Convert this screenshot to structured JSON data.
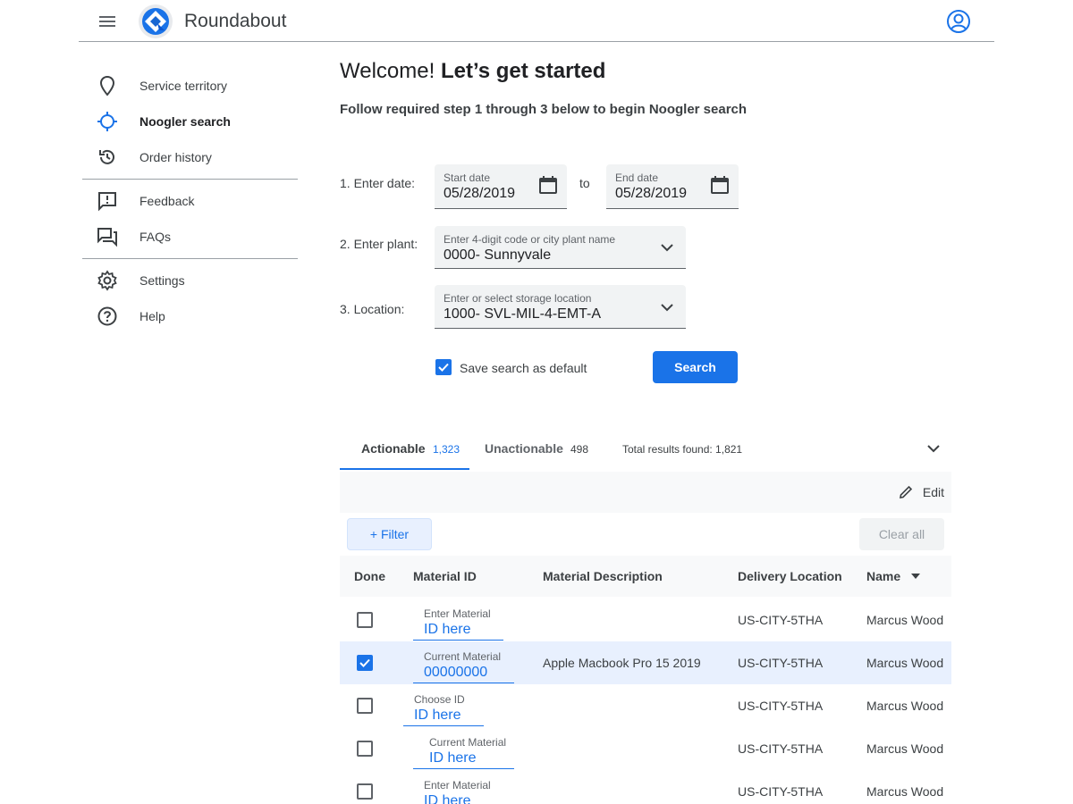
{
  "app": {
    "title": "Roundabout",
    "accent": "#1a73e8"
  },
  "sidebar": {
    "items": [
      {
        "label": "Service territory",
        "icon": "map-pin-icon"
      },
      {
        "label": "Noogler search",
        "icon": "crosshair-icon",
        "active": true
      },
      {
        "label": "Order history",
        "icon": "history-icon"
      },
      {
        "label": "Feedback",
        "icon": "feedback-icon"
      },
      {
        "label": "FAQs",
        "icon": "forum-icon"
      },
      {
        "label": "Settings",
        "icon": "gear-icon"
      },
      {
        "label": "Help",
        "icon": "help-icon"
      }
    ]
  },
  "main": {
    "welcome": "Welcome!",
    "welcome_bold": "Let’s get started",
    "subtitle": "Follow required step 1 through 3 below to begin Noogler search"
  },
  "form": {
    "step1_label": "1. Enter date:",
    "start_label": "Start date",
    "start_value": "05/28/2019",
    "to_text": "to",
    "end_label": "End date",
    "end_value": "05/28/2019",
    "step2_label": "2. Enter plant:",
    "plant_label": "Enter 4-digit code or city plant name",
    "plant_value": "0000- Sunnyvale",
    "step3_label": "3. Location:",
    "location_label": "Enter or select storage location",
    "location_value": "1000- SVL-MIL-4-EMT-A",
    "save_default_label": "Save search as default",
    "save_default_checked": true,
    "search_label": "Search"
  },
  "results": {
    "tab_actionable": "Actionable",
    "tab_actionable_count": "1,323",
    "tab_unactionable": "Unactionable",
    "tab_unactionable_count": "498",
    "total": "Total results found: 1,821",
    "edit_label": "Edit",
    "filter_label": "+ Filter",
    "clear_label": "Clear all"
  },
  "table": {
    "headers": [
      "Done",
      "Material ID",
      "Material Description",
      "Delivery Location",
      "Name"
    ],
    "rows": [
      {
        "done": false,
        "mat_label": "Enter Material",
        "mat_value": "ID here",
        "description": "",
        "location": "US-CITY-5THA",
        "name": "Marcus Wood"
      },
      {
        "done": true,
        "mat_label": "Current Material",
        "mat_value": "00000000",
        "description": "Apple Macbook Pro 15 2019",
        "location": "US-CITY-5THA",
        "name": "Marcus Wood"
      },
      {
        "done": false,
        "mat_label": "Choose ID",
        "mat_value": "ID here",
        "description": "",
        "location": "US-CITY-5THA",
        "name": "Marcus Wood"
      },
      {
        "done": false,
        "mat_label": "Current Material",
        "mat_value": "ID here",
        "description": "",
        "location": "US-CITY-5THA",
        "name": "Marcus Wood"
      },
      {
        "done": false,
        "mat_label": "Enter Material",
        "mat_value": "ID here",
        "description": "",
        "location": "US-CITY-5THA",
        "name": "Marcus Wood"
      }
    ]
  }
}
